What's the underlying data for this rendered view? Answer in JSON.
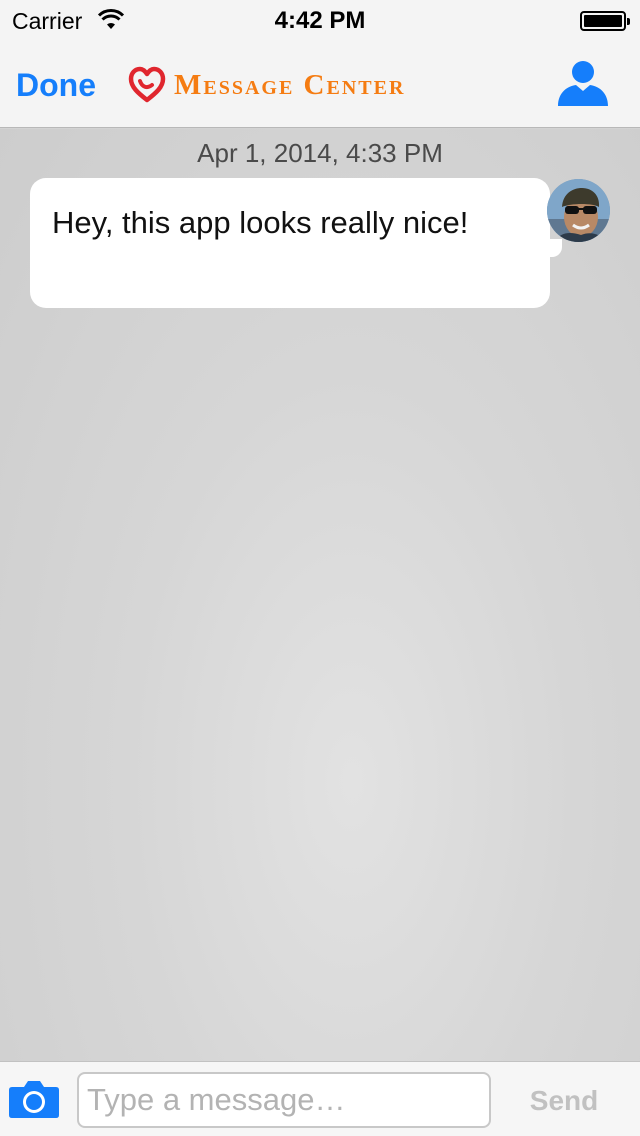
{
  "status_bar": {
    "carrier": "Carrier",
    "time": "4:42 PM"
  },
  "nav": {
    "done_label": "Done",
    "title": "Message Center",
    "logo_icon": "heart-logo-icon",
    "profile_icon": "person-icon"
  },
  "conversation": {
    "timestamp": "Apr 1, 2014, 4:33 PM",
    "messages": [
      {
        "text": "Hey, this app looks really nice!",
        "avatar_icon": "user-avatar"
      }
    ]
  },
  "composer": {
    "camera_icon": "camera-icon",
    "placeholder": "Type a message…",
    "value": "",
    "send_label": "Send"
  },
  "colors": {
    "accent": "#157efb",
    "brand": "#f57c12",
    "send_disabled": "#c1c1c1",
    "background": "#d3d3d3"
  }
}
